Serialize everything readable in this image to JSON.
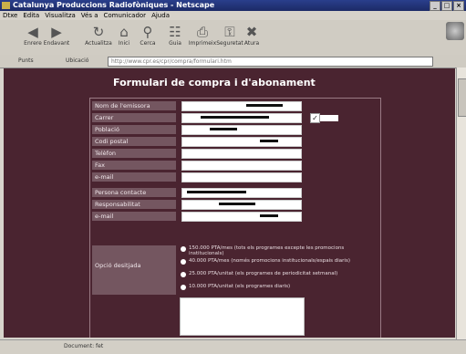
{
  "window": {
    "title": "Catalunya Produccions Radiofòniques - Netscape"
  },
  "menu": [
    "Dtxe",
    "Edita",
    "Visualitza",
    "Vés a",
    "Comunicador",
    "Ajuda"
  ],
  "toolbar": [
    {
      "label": "Enrere",
      "icon": "back-arrow-icon",
      "glyph": "◀"
    },
    {
      "label": "Endavant",
      "icon": "forward-arrow-icon",
      "glyph": "▶"
    },
    {
      "label": "Actualitza",
      "icon": "reload-icon",
      "glyph": "↻"
    },
    {
      "label": "Inici",
      "icon": "home-icon",
      "glyph": "⌂"
    },
    {
      "label": "Cerca",
      "icon": "search-icon",
      "glyph": "⚲"
    },
    {
      "label": "Guia",
      "icon": "guide-icon",
      "glyph": "☷"
    },
    {
      "label": "Imprimeix",
      "icon": "print-icon",
      "glyph": "⎙"
    },
    {
      "label": "Seguretat",
      "icon": "security-lock-icon",
      "glyph": "⚿"
    },
    {
      "label": "Atura",
      "icon": "stop-icon",
      "glyph": "✖"
    }
  ],
  "location": {
    "bookmarks": "Punts",
    "label": "Ubicació",
    "url": "http://www.cpr.es/cpr/compra/formulari.htm"
  },
  "page": {
    "heading": "Formulari de compra i d'abonament"
  },
  "form": {
    "fields": [
      {
        "label": "Nom de l'emissora"
      },
      {
        "label": "Carrer"
      },
      {
        "label": "Població"
      },
      {
        "label": "Codi postal"
      },
      {
        "label": "Telèfon"
      },
      {
        "label": "Fax"
      },
      {
        "label": "e-mail"
      },
      {
        "label": "Persona contacte"
      },
      {
        "label": "Responsabilitat"
      },
      {
        "label": "e-mail"
      }
    ],
    "options_label": "Opció desitjada",
    "options": [
      "150.000 PTA/mes (tots els programes excepte les promocions institucionals)",
      "40.000 PTA/mes (només promocions institucionals/espais diaris)",
      "25.000 PTA/unitat (els programes de periodicitat setmanal)",
      "10.000 PTA/unitat (els programes diaris)"
    ]
  },
  "status": {
    "text": "Document: fet"
  }
}
